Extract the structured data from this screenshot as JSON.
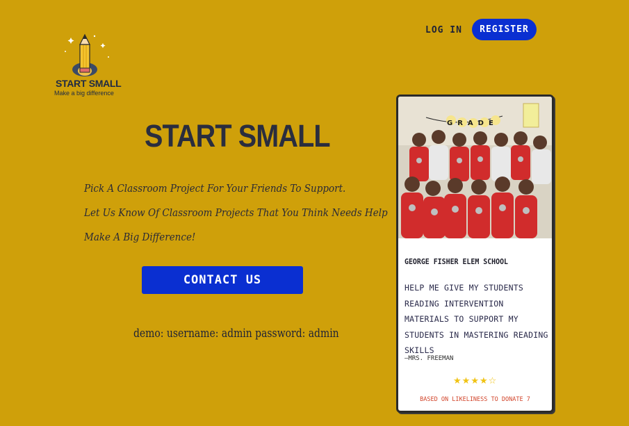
{
  "nav": {
    "login_label": "LOG IN",
    "register_label": "REGISTER"
  },
  "logo": {
    "title": "START SMALL",
    "subtitle": "Make a big difference"
  },
  "hero": {
    "title": "START SMALL",
    "taglines": [
      "Pick A Classroom Project For Your Friends To Support.",
      "Let Us Know Of Classroom Projects That You Think Needs Help",
      "Make A Big Difference!"
    ],
    "contact_label": "CONTACT US",
    "demo_text": "demo: username: admin password: admin"
  },
  "card": {
    "school": "GEORGE FISHER ELEM SCHOOL",
    "project": "HELP ME GIVE MY STUDENTS READING INTERVENTION MATERIALS TO SUPPORT MY STUDENTS IN MASTERING READING SKILLS",
    "teacher": "—MRS. FREEMAN",
    "rating": {
      "value": 4,
      "max": 5
    },
    "stars_text": "★★★★☆",
    "based_on": "BASED ON LIKELINESS TO DONATE 7",
    "photo_banner": "GRADE"
  },
  "colors": {
    "background": "#cfa00a",
    "accent": "#0a2fd1",
    "text": "#2a2d3e"
  }
}
